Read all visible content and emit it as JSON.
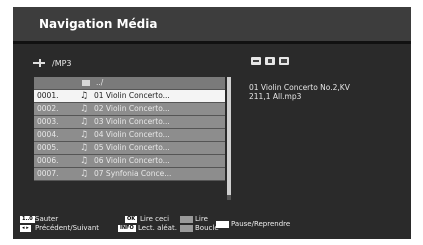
{
  "header": {
    "title": "Navigation Média"
  },
  "path": {
    "icon": "usb-icon",
    "text": "/MP3"
  },
  "status_icons": [
    "repeat-icon",
    "shuffle-icon",
    "display-icon"
  ],
  "file_list": {
    "parent": "../",
    "items": [
      {
        "num": "0001.",
        "name": "01 Violin Concerto...",
        "selected": true
      },
      {
        "num": "0002.",
        "name": "02 Violin Concerto..."
      },
      {
        "num": "0003.",
        "name": "03 Violin Concerto..."
      },
      {
        "num": "0004.",
        "name": "04 Violin Concerto..."
      },
      {
        "num": "0005.",
        "name": "05 Violin Concerto..."
      },
      {
        "num": "0006.",
        "name": "06 Violin Concerto..."
      },
      {
        "num": "0007.",
        "name": "07 Synfonia Conce..."
      }
    ]
  },
  "info": {
    "line1": "01 Violin Concerto No.2,KV",
    "line2": "211,1 All.mp3"
  },
  "footer": {
    "key1": "1..0",
    "sauter": "Sauter",
    "prev_next": "Précédent/Suivant",
    "ok_key": "OK",
    "lire_ceci": "Lire ceci",
    "info_key": "INFO",
    "lect_aleat": "Lect. aléat.",
    "lire": "Lire",
    "boucle": "Boucle",
    "pause": "Pause/Reprendre",
    "colors": {
      "swatch1": "#9a9a9a",
      "swatch2": "#9a9a9a",
      "swatch3": "#ffffff"
    }
  }
}
